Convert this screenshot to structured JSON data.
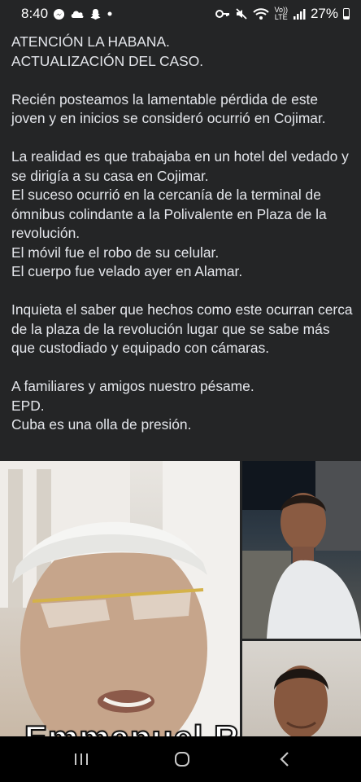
{
  "status_bar": {
    "time": "8:40",
    "volte": "Vo))",
    "lte": "LTE",
    "battery": "27%",
    "battery_level": 0.27,
    "notification_icons": [
      "messenger-icon",
      "cloud-icon",
      "snapchat-icon",
      "dot-icon"
    ],
    "system_icons": [
      "key-icon",
      "mute-icon",
      "wifi-icon",
      "signal-icon",
      "battery-icon"
    ]
  },
  "post": {
    "paragraphs": [
      "ATENCIÓN LA HABANA.\nACTUALIZACIÓN DEL CASO.",
      "Recién posteamos la lamentable pérdida de este joven y en inicios se consideró ocurrió en Cojimar.",
      "La realidad es que trabajaba en un hotel del vedado  y se dirigía a su casa en Cojimar.\nEl suceso ocurrió en la cercanía de la terminal de ómnibus colindante a la Polivalente en Plaza de la revolución.\nEl móvil fue el robo de su celular.\nEl cuerpo fue velado ayer en Alamar.",
      "Inquieta el saber que hechos como este ocurran cerca de la plaza de la revolución lugar que se sabe más que custodiado y equipado con cámaras.",
      "A familiares y amigos nuestro pésame.\nEPD.\nCuba es una olla de presión."
    ]
  },
  "photos": {
    "caption": "Emmanuel Roc"
  },
  "nav_bar": {
    "icons": [
      "recent-apps-icon",
      "home-icon",
      "back-icon"
    ]
  }
}
